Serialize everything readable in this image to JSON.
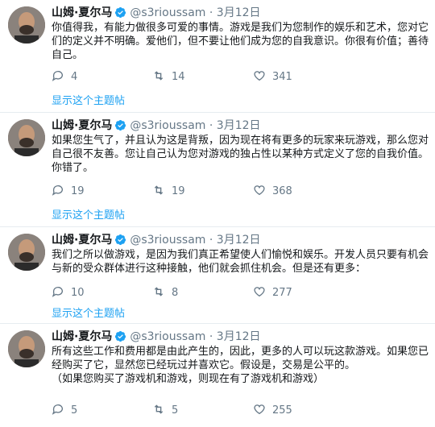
{
  "tweets": [
    {
      "name": "山姆·夏尔马",
      "handle": "@s3rioussam",
      "sep": "·",
      "date": "3月12日",
      "text": "你值得我，有能力做很多可爱的事情。游戏是我们为您制作的娱乐和艺术，您对它们的定义并不明确。爱他们，但不要让他们成为您的自我意识。你很有价值；善待自己。",
      "reply_count": "4",
      "retweet_count": "14",
      "like_count": "341",
      "thread_link": "显示这个主题帖"
    },
    {
      "name": "山姆·夏尔马",
      "handle": "@s3rioussam",
      "sep": "·",
      "date": "3月12日",
      "text": "如果您生气了，并且认为这是背叛，因为现在将有更多的玩家来玩游戏，那么您对自己很不友善。您让自己认为您对游戏的独占性以某种方式定义了您的自我价值。你错了。",
      "reply_count": "19",
      "retweet_count": "19",
      "like_count": "368",
      "thread_link": "显示这个主题帖"
    },
    {
      "name": "山姆·夏尔马",
      "handle": "@s3rioussam",
      "sep": "·",
      "date": "3月12日",
      "text": "我们之所以做游戏，是因为我们真正希望使人们愉悦和娱乐。开发人员只要有机会与新的受众群体进行这种接触，他们就会抓住机会。但是还有更多：",
      "reply_count": "10",
      "retweet_count": "8",
      "like_count": "277",
      "thread_link": "显示这个主题帖"
    },
    {
      "name": "山姆·夏尔马",
      "handle": "@s3rioussam",
      "sep": "·",
      "date": "3月12日",
      "text": "所有这些工作和费用都是由此产生的，因此，更多的人可以玩这款游戏。如果您已经购买了它，显然您已经玩过并喜欢它。假设是，交易是公平的。\n（如果您购买了游戏机和游戏，则现在有了游戏机和游戏）",
      "reply_count": "5",
      "retweet_count": "5",
      "like_count": "255",
      "thread_link": ""
    }
  ],
  "icons": {
    "reply": "reply-icon",
    "retweet": "retweet-icon",
    "like": "like-icon",
    "verified": "verified-badge-icon"
  },
  "colors": {
    "link": "#1da1f2",
    "muted": "#657786",
    "verified": "#1da1f2"
  }
}
